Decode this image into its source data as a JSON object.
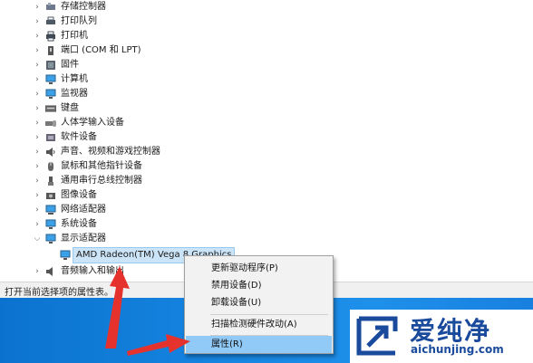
{
  "device_tree": {
    "categories": [
      {
        "label": "存储控制器",
        "state": "collapsed",
        "icon": "storage-controller-icon"
      },
      {
        "label": "打印队列",
        "state": "collapsed",
        "icon": "print-queue-icon"
      },
      {
        "label": "打印机",
        "state": "collapsed",
        "icon": "printer-icon"
      },
      {
        "label": "端口 (COM 和 LPT)",
        "state": "collapsed",
        "icon": "port-icon"
      },
      {
        "label": "固件",
        "state": "collapsed",
        "icon": "firmware-icon"
      },
      {
        "label": "计算机",
        "state": "collapsed",
        "icon": "computer-icon"
      },
      {
        "label": "监视器",
        "state": "collapsed",
        "icon": "monitor-icon"
      },
      {
        "label": "键盘",
        "state": "collapsed",
        "icon": "keyboard-icon"
      },
      {
        "label": "人体学输入设备",
        "state": "collapsed",
        "icon": "hid-icon"
      },
      {
        "label": "软件设备",
        "state": "collapsed",
        "icon": "software-device-icon"
      },
      {
        "label": "声音、视频和游戏控制器",
        "state": "collapsed",
        "icon": "sound-icon"
      },
      {
        "label": "鼠标和其他指针设备",
        "state": "collapsed",
        "icon": "mouse-icon"
      },
      {
        "label": "通用串行总线控制器",
        "state": "collapsed",
        "icon": "usb-icon"
      },
      {
        "label": "图像设备",
        "state": "collapsed",
        "icon": "camera-icon"
      },
      {
        "label": "网络适配器",
        "state": "collapsed",
        "icon": "network-adapter-icon"
      },
      {
        "label": "系统设备",
        "state": "collapsed",
        "icon": "system-device-icon"
      },
      {
        "label": "显示适配器",
        "state": "expanded",
        "icon": "display-adapter-icon"
      },
      {
        "label": "AMD Radeon(TM) Vega 8 Graphics",
        "state": "selected",
        "icon": "gpu-icon"
      },
      {
        "label": "音频输入和输出",
        "state": "collapsed",
        "icon": "audio-icon"
      }
    ]
  },
  "status_bar": {
    "text": "打开当前选择项的属性表。"
  },
  "context_menu": {
    "items": [
      {
        "label": "更新驱动程序(P)"
      },
      {
        "label": "禁用设备(D)"
      },
      {
        "label": "卸载设备(U)"
      },
      {
        "label": "扫描检测硬件改动(A)"
      },
      {
        "label": "属性(R)"
      }
    ]
  },
  "watermark": {
    "brand": "爱纯净",
    "url": "aichunjing.com"
  },
  "colors": {
    "highlight": "#91c9f7",
    "desktop_blue": "#1686e2",
    "arrow_red": "#e5322d",
    "brand_blue": "#1a4a9c"
  }
}
